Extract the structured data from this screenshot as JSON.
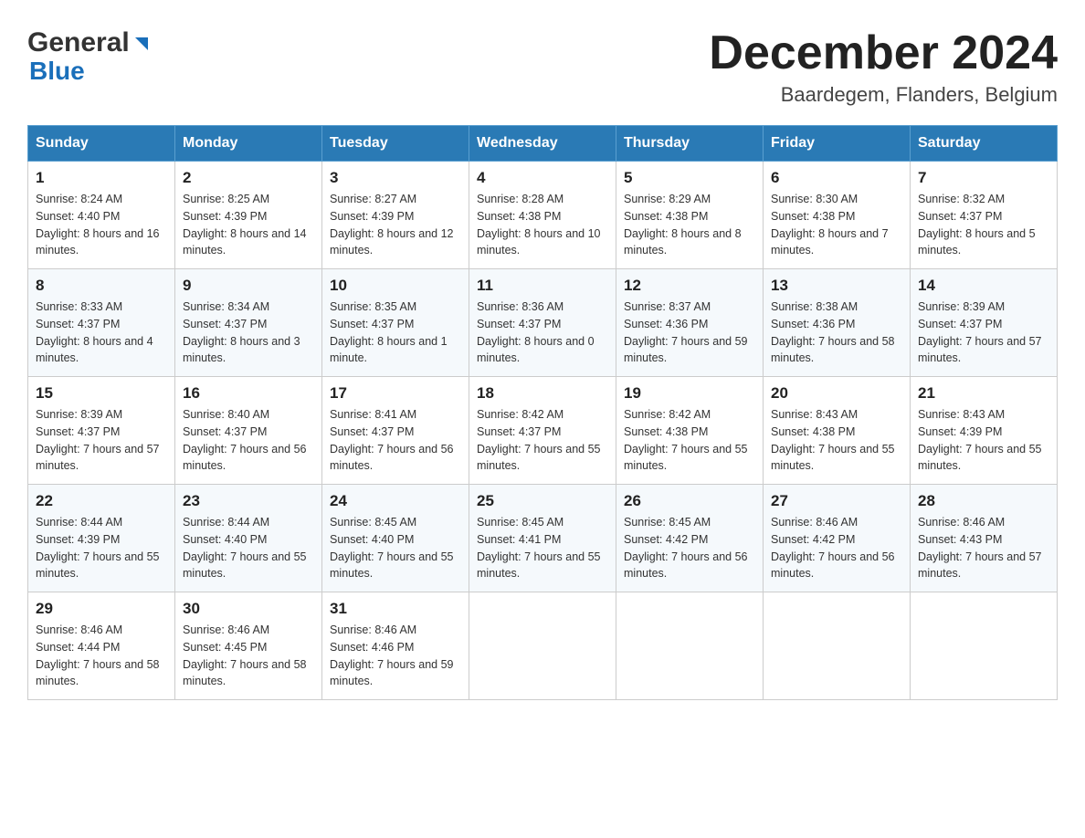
{
  "header": {
    "logo_general": "General",
    "logo_blue": "Blue",
    "month_title": "December 2024",
    "location": "Baardegem, Flanders, Belgium"
  },
  "calendar": {
    "days_of_week": [
      "Sunday",
      "Monday",
      "Tuesday",
      "Wednesday",
      "Thursday",
      "Friday",
      "Saturday"
    ],
    "weeks": [
      [
        {
          "day": "1",
          "sunrise": "Sunrise: 8:24 AM",
          "sunset": "Sunset: 4:40 PM",
          "daylight": "Daylight: 8 hours and 16 minutes."
        },
        {
          "day": "2",
          "sunrise": "Sunrise: 8:25 AM",
          "sunset": "Sunset: 4:39 PM",
          "daylight": "Daylight: 8 hours and 14 minutes."
        },
        {
          "day": "3",
          "sunrise": "Sunrise: 8:27 AM",
          "sunset": "Sunset: 4:39 PM",
          "daylight": "Daylight: 8 hours and 12 minutes."
        },
        {
          "day": "4",
          "sunrise": "Sunrise: 8:28 AM",
          "sunset": "Sunset: 4:38 PM",
          "daylight": "Daylight: 8 hours and 10 minutes."
        },
        {
          "day": "5",
          "sunrise": "Sunrise: 8:29 AM",
          "sunset": "Sunset: 4:38 PM",
          "daylight": "Daylight: 8 hours and 8 minutes."
        },
        {
          "day": "6",
          "sunrise": "Sunrise: 8:30 AM",
          "sunset": "Sunset: 4:38 PM",
          "daylight": "Daylight: 8 hours and 7 minutes."
        },
        {
          "day": "7",
          "sunrise": "Sunrise: 8:32 AM",
          "sunset": "Sunset: 4:37 PM",
          "daylight": "Daylight: 8 hours and 5 minutes."
        }
      ],
      [
        {
          "day": "8",
          "sunrise": "Sunrise: 8:33 AM",
          "sunset": "Sunset: 4:37 PM",
          "daylight": "Daylight: 8 hours and 4 minutes."
        },
        {
          "day": "9",
          "sunrise": "Sunrise: 8:34 AM",
          "sunset": "Sunset: 4:37 PM",
          "daylight": "Daylight: 8 hours and 3 minutes."
        },
        {
          "day": "10",
          "sunrise": "Sunrise: 8:35 AM",
          "sunset": "Sunset: 4:37 PM",
          "daylight": "Daylight: 8 hours and 1 minute."
        },
        {
          "day": "11",
          "sunrise": "Sunrise: 8:36 AM",
          "sunset": "Sunset: 4:37 PM",
          "daylight": "Daylight: 8 hours and 0 minutes."
        },
        {
          "day": "12",
          "sunrise": "Sunrise: 8:37 AM",
          "sunset": "Sunset: 4:36 PM",
          "daylight": "Daylight: 7 hours and 59 minutes."
        },
        {
          "day": "13",
          "sunrise": "Sunrise: 8:38 AM",
          "sunset": "Sunset: 4:36 PM",
          "daylight": "Daylight: 7 hours and 58 minutes."
        },
        {
          "day": "14",
          "sunrise": "Sunrise: 8:39 AM",
          "sunset": "Sunset: 4:37 PM",
          "daylight": "Daylight: 7 hours and 57 minutes."
        }
      ],
      [
        {
          "day": "15",
          "sunrise": "Sunrise: 8:39 AM",
          "sunset": "Sunset: 4:37 PM",
          "daylight": "Daylight: 7 hours and 57 minutes."
        },
        {
          "day": "16",
          "sunrise": "Sunrise: 8:40 AM",
          "sunset": "Sunset: 4:37 PM",
          "daylight": "Daylight: 7 hours and 56 minutes."
        },
        {
          "day": "17",
          "sunrise": "Sunrise: 8:41 AM",
          "sunset": "Sunset: 4:37 PM",
          "daylight": "Daylight: 7 hours and 56 minutes."
        },
        {
          "day": "18",
          "sunrise": "Sunrise: 8:42 AM",
          "sunset": "Sunset: 4:37 PM",
          "daylight": "Daylight: 7 hours and 55 minutes."
        },
        {
          "day": "19",
          "sunrise": "Sunrise: 8:42 AM",
          "sunset": "Sunset: 4:38 PM",
          "daylight": "Daylight: 7 hours and 55 minutes."
        },
        {
          "day": "20",
          "sunrise": "Sunrise: 8:43 AM",
          "sunset": "Sunset: 4:38 PM",
          "daylight": "Daylight: 7 hours and 55 minutes."
        },
        {
          "day": "21",
          "sunrise": "Sunrise: 8:43 AM",
          "sunset": "Sunset: 4:39 PM",
          "daylight": "Daylight: 7 hours and 55 minutes."
        }
      ],
      [
        {
          "day": "22",
          "sunrise": "Sunrise: 8:44 AM",
          "sunset": "Sunset: 4:39 PM",
          "daylight": "Daylight: 7 hours and 55 minutes."
        },
        {
          "day": "23",
          "sunrise": "Sunrise: 8:44 AM",
          "sunset": "Sunset: 4:40 PM",
          "daylight": "Daylight: 7 hours and 55 minutes."
        },
        {
          "day": "24",
          "sunrise": "Sunrise: 8:45 AM",
          "sunset": "Sunset: 4:40 PM",
          "daylight": "Daylight: 7 hours and 55 minutes."
        },
        {
          "day": "25",
          "sunrise": "Sunrise: 8:45 AM",
          "sunset": "Sunset: 4:41 PM",
          "daylight": "Daylight: 7 hours and 55 minutes."
        },
        {
          "day": "26",
          "sunrise": "Sunrise: 8:45 AM",
          "sunset": "Sunset: 4:42 PM",
          "daylight": "Daylight: 7 hours and 56 minutes."
        },
        {
          "day": "27",
          "sunrise": "Sunrise: 8:46 AM",
          "sunset": "Sunset: 4:42 PM",
          "daylight": "Daylight: 7 hours and 56 minutes."
        },
        {
          "day": "28",
          "sunrise": "Sunrise: 8:46 AM",
          "sunset": "Sunset: 4:43 PM",
          "daylight": "Daylight: 7 hours and 57 minutes."
        }
      ],
      [
        {
          "day": "29",
          "sunrise": "Sunrise: 8:46 AM",
          "sunset": "Sunset: 4:44 PM",
          "daylight": "Daylight: 7 hours and 58 minutes."
        },
        {
          "day": "30",
          "sunrise": "Sunrise: 8:46 AM",
          "sunset": "Sunset: 4:45 PM",
          "daylight": "Daylight: 7 hours and 58 minutes."
        },
        {
          "day": "31",
          "sunrise": "Sunrise: 8:46 AM",
          "sunset": "Sunset: 4:46 PM",
          "daylight": "Daylight: 7 hours and 59 minutes."
        },
        null,
        null,
        null,
        null
      ]
    ]
  }
}
